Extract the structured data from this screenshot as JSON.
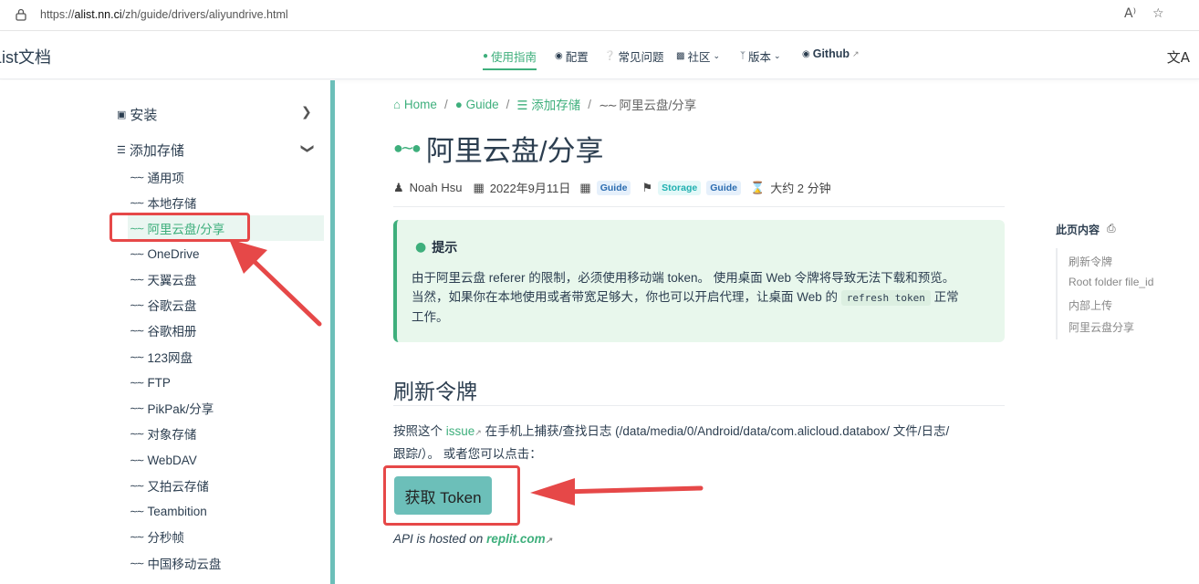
{
  "browser": {
    "url_prefix": "https://",
    "url_host": "alist.nn.ci",
    "url_path": "/zh/guide/drivers/aliyundrive.html",
    "read_aloud": "A⁾",
    "favorite": "☆"
  },
  "navbar": {
    "brand": "List文档",
    "items": [
      {
        "label": "使用指南",
        "active": true
      },
      {
        "label": "配置"
      },
      {
        "label": "常见问题"
      },
      {
        "label": "社区"
      },
      {
        "label": "版本"
      },
      {
        "label": "Github"
      }
    ],
    "translate": "文A"
  },
  "sidebar": {
    "install": "安装",
    "add_storage": "添加存储",
    "items": [
      "通用项",
      "本地存储",
      "阿里云盘/分享",
      "OneDrive",
      "天翼云盘",
      "谷歌云盘",
      "谷歌相册",
      "123网盘",
      "FTP",
      "PikPak/分享",
      "对象存储",
      "WebDAV",
      "又拍云存储",
      "Teambition",
      "分秒帧",
      "中国移动云盘"
    ]
  },
  "breadcrumb": {
    "home": "Home",
    "guide": "Guide",
    "add_storage": "添加存储",
    "current": "阿里云盘/分享"
  },
  "page": {
    "title": "阿里云盘/分享",
    "author": "Noah Hsu",
    "date": "2022年9月11日",
    "category": "Guide",
    "tag_storage": "Storage",
    "tag_guide": "Guide",
    "read_time": "大约 2 分钟"
  },
  "tip": {
    "title": "提示",
    "line1": "由于阿里云盘 referer 的限制，必须使用移动端 token。 使用桌面 Web 令牌将导致无法下载和预览。",
    "line2_a": "当然，如果你在本地使用或者带宽足够大，你也可以开启代理，让桌面 Web 的",
    "code": "refresh token",
    "line2_b": "正常",
    "line3": "工作。"
  },
  "section": {
    "title": "刷新令牌",
    "para_a": "按照这个",
    "issue_link": "issue",
    "para_b": "在手机上捕获/查找日志 (/data/media/0/Android/data/com.alicloud.databox/ 文件/日志/",
    "para_c": "跟踪/）。 或者您可以点击：",
    "button": "获取 Token",
    "api_note": "API is hosted on",
    "api_link": "replit.com"
  },
  "toc": {
    "title": "此页内容",
    "items": [
      "刷新令牌",
      "Root folder file_id",
      "内部上传",
      "阿里云盘分享"
    ]
  },
  "colors": {
    "accent": "#3eaf7c",
    "sidebar_divider": "#6cbfb9",
    "annotation_red": "#e64848"
  }
}
